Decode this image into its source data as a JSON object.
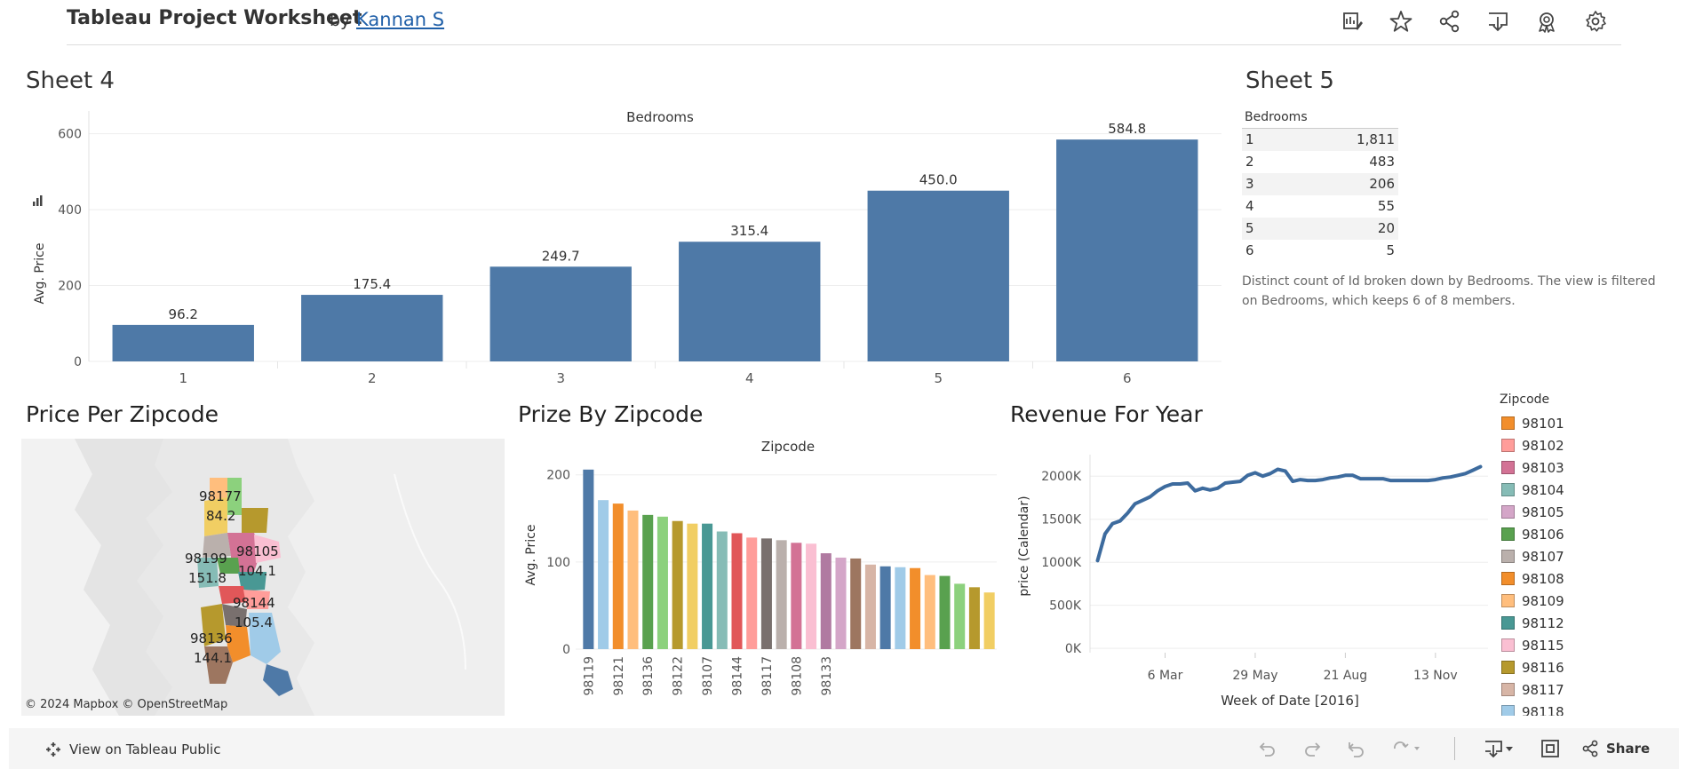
{
  "header": {
    "title": "Tableau Project Worksheet",
    "by": "by",
    "author": "Kannan S",
    "icons": [
      "edit-icon",
      "star-icon",
      "share-icon",
      "download-icon",
      "badge-icon",
      "settings-icon"
    ]
  },
  "sheet4": {
    "title": "Sheet 4",
    "chart_data": {
      "type": "bar",
      "title": "Bedrooms",
      "ylabel": "Avg. Price",
      "categories": [
        "1",
        "2",
        "3",
        "4",
        "5",
        "6"
      ],
      "values": [
        96.2,
        175.4,
        249.7,
        315.4,
        450.0,
        584.8
      ],
      "value_labels": [
        "96.2",
        "175.4",
        "249.7",
        "315.4",
        "450.0",
        "584.8"
      ],
      "yticks": [
        0,
        200,
        400,
        600
      ],
      "ylim": [
        0,
        660
      ],
      "color": "#4e79a7",
      "grid": true
    }
  },
  "sheet5": {
    "title": "Sheet 5",
    "column_header": "Bedrooms",
    "rows": [
      {
        "label": "1",
        "value": "1,811"
      },
      {
        "label": "2",
        "value": "483"
      },
      {
        "label": "3",
        "value": "206"
      },
      {
        "label": "4",
        "value": "55"
      },
      {
        "label": "5",
        "value": "20"
      },
      {
        "label": "6",
        "value": "5"
      }
    ],
    "note": "Distinct count of Id broken down by Bedrooms. The view is filtered on Bedrooms, which keeps 6 of 8 members."
  },
  "price_per_zipcode": {
    "title": "Price Per Zipcode",
    "attribution": "© 2024 Mapbox  © OpenStreetMap",
    "labels": [
      {
        "zip": "98177",
        "value": "84.2"
      },
      {
        "zip": "98105",
        "value": ""
      },
      {
        "zip": "98199",
        "value": "151.8"
      },
      {
        "zip": "",
        "value": "104.1"
      },
      {
        "zip": "98144",
        "value": "105.4"
      },
      {
        "zip": "98136",
        "value": "144.1"
      }
    ]
  },
  "prize_by_zipcode": {
    "title": "Prize By Zipcode",
    "chart_data": {
      "type": "bar",
      "title": "Zipcode",
      "ylabel": "Avg. Price",
      "yticks": [
        0,
        100,
        200
      ],
      "ylim": [
        0,
        215
      ],
      "values": [
        206,
        171,
        167,
        159,
        154,
        152,
        147,
        144,
        144,
        135,
        133,
        128,
        127,
        125,
        122,
        121,
        110,
        105,
        104,
        97,
        95,
        94,
        93,
        85,
        84,
        75,
        71,
        65
      ],
      "colors": [
        "#4e79a7",
        "#a0cbe8",
        "#f28e2b",
        "#ffbe7d",
        "#59a14f",
        "#8cd17d",
        "#b6992d",
        "#f1ce63",
        "#499894",
        "#86bcb6",
        "#e15759",
        "#ff9d9a",
        "#79706e",
        "#bab0ac",
        "#d37295",
        "#fabfd2",
        "#b07aa1",
        "#d4a6c8",
        "#9d7660",
        "#d7b5a6",
        "#4e79a7",
        "#a0cbe8",
        "#f28e2b",
        "#ffbe7d",
        "#59a14f",
        "#8cd17d",
        "#b6992d",
        "#f1ce63"
      ],
      "tick_labels": [
        "98119",
        "98121",
        "98136",
        "98122",
        "98107",
        "98144",
        "98117",
        "98108",
        "98133"
      ],
      "tick_label_every": 2,
      "grid": true
    }
  },
  "revenue_for_year": {
    "title": "Revenue For Year",
    "chart_data": {
      "type": "line",
      "xlabel": "Week of Date [2016]",
      "ylabel": "price (Calendar)",
      "ytick_labels": [
        "0K",
        "500K",
        "1000K",
        "1500K",
        "2000K"
      ],
      "yticks": [
        0,
        500000,
        1000000,
        1500000,
        2000000
      ],
      "ylim": [
        -50000,
        2250000
      ],
      "xtick_labels": [
        "6 Mar",
        "29 May",
        "21 Aug",
        "13 Nov"
      ],
      "xtick_weeks": [
        10,
        22,
        34,
        46
      ],
      "xlim": [
        0,
        53
      ],
      "color": "#3d6b9e",
      "weeks": [
        1,
        2,
        3,
        4,
        5,
        6,
        7,
        8,
        9,
        10,
        11,
        12,
        13,
        14,
        15,
        16,
        17,
        18,
        19,
        20,
        21,
        22,
        23,
        24,
        25,
        26,
        27,
        28,
        29,
        30,
        31,
        32,
        33,
        34,
        35,
        36,
        37,
        38,
        39,
        40,
        41,
        42,
        43,
        44,
        45,
        46,
        47,
        48,
        49,
        50,
        51,
        52
      ],
      "values": [
        1020000,
        1330000,
        1450000,
        1480000,
        1570000,
        1680000,
        1720000,
        1760000,
        1830000,
        1880000,
        1910000,
        1910000,
        1920000,
        1830000,
        1860000,
        1840000,
        1860000,
        1920000,
        1930000,
        1940000,
        2010000,
        2040000,
        2000000,
        2030000,
        2080000,
        2060000,
        1940000,
        1960000,
        1950000,
        1950000,
        1960000,
        1980000,
        1990000,
        2010000,
        2010000,
        1970000,
        1970000,
        1970000,
        1970000,
        1950000,
        1950000,
        1950000,
        1950000,
        1950000,
        1950000,
        1960000,
        1980000,
        1990000,
        2010000,
        2030000,
        2070000,
        2110000
      ],
      "grid": true
    }
  },
  "legend": {
    "title": "Zipcode",
    "items": [
      {
        "label": "98101",
        "color": "#f28e2b"
      },
      {
        "label": "98102",
        "color": "#ff9d9a"
      },
      {
        "label": "98103",
        "color": "#d37295"
      },
      {
        "label": "98104",
        "color": "#86bcb6"
      },
      {
        "label": "98105",
        "color": "#d4a6c8"
      },
      {
        "label": "98106",
        "color": "#59a14f"
      },
      {
        "label": "98107",
        "color": "#bab0ac"
      },
      {
        "label": "98108",
        "color": "#f28e2b"
      },
      {
        "label": "98109",
        "color": "#ffbe7d"
      },
      {
        "label": "98112",
        "color": "#499894"
      },
      {
        "label": "98115",
        "color": "#fabfd2"
      },
      {
        "label": "98116",
        "color": "#b6992d"
      },
      {
        "label": "98117",
        "color": "#d7b5a6"
      },
      {
        "label": "98118",
        "color": "#a0cbe8"
      }
    ]
  },
  "footer": {
    "view_label": "View on Tableau Public",
    "share_label": "Share"
  }
}
